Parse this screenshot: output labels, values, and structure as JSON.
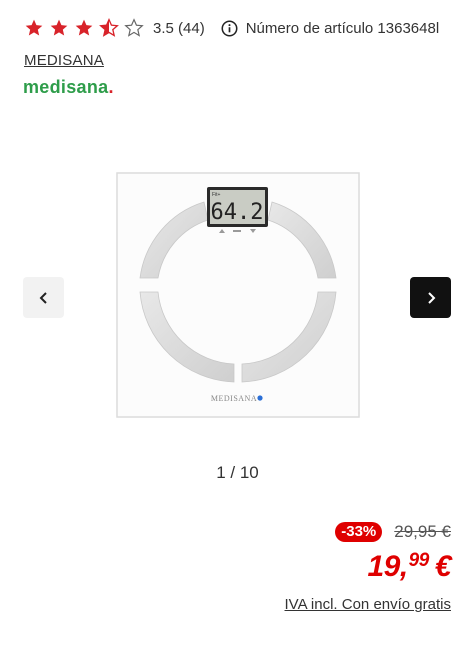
{
  "rating": {
    "value": 3.5,
    "text": "3.5 (44)",
    "stars": [
      "full",
      "full",
      "full",
      "half",
      "empty"
    ],
    "star_color": "#d8232a"
  },
  "article": {
    "label": "Número de artículo 1363648l",
    "icon": "info-icon"
  },
  "brand": {
    "link_text": "MEDISANA",
    "logo_text": "medisana",
    "logo_dot": ".",
    "logo_color": "#2e9d4a",
    "logo_dot_color": "#d8232a"
  },
  "gallery": {
    "display_value": "64.2",
    "display_left_label": "Fit+",
    "scale_brand": "MEDISANA",
    "counter": "1 / 10",
    "prev_icon": "chevron-left-icon",
    "next_icon": "chevron-right-icon"
  },
  "price": {
    "discount": "-33%",
    "old_price": "29,95 €",
    "new_price_main": "19,",
    "new_price_cents": "99",
    "currency": "€",
    "accent": "#df0000",
    "tax_note": "IVA incl. Con envío gratis"
  }
}
